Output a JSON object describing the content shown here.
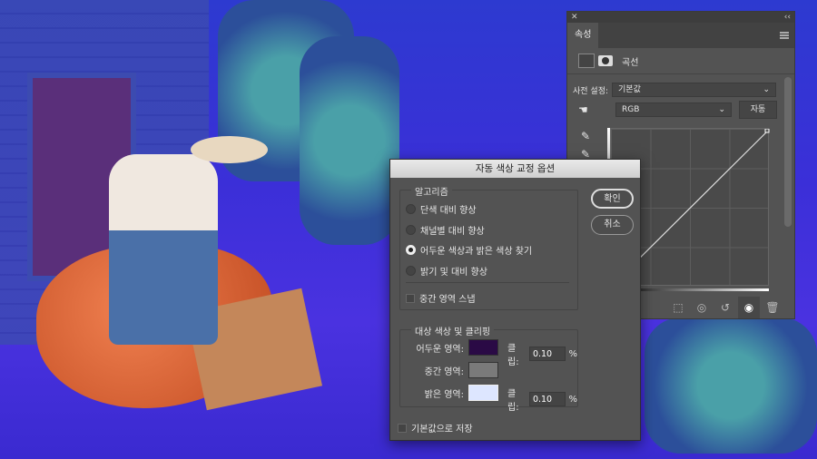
{
  "properties_panel": {
    "close": "✕",
    "collapse": "‹‹",
    "tab": "속성",
    "type_label": "곡선",
    "preset_label": "사전 설정:",
    "preset_value": "기본값",
    "channel_value": "RGB",
    "auto_button": "자동"
  },
  "dialog": {
    "title": "자동 색상 교정 옵션",
    "algorithm_label": "알고리즘",
    "algorithms": [
      {
        "label": "단색 대비 향상",
        "selected": false
      },
      {
        "label": "채널별 대비 향상",
        "selected": false
      },
      {
        "label": "어두운 색상과 밝은 색상 찾기",
        "selected": true
      },
      {
        "label": "밝기 및 대비 향상",
        "selected": false
      }
    ],
    "snap_midtones": {
      "label": "중간 영역 스냅",
      "checked": false
    },
    "target_label": "대상 색상 및 클리핑",
    "shadows": {
      "label": "어두운 영역:",
      "color": "#2a0a45",
      "clip_label": "클립:",
      "clip": "0.10",
      "unit": "%"
    },
    "midtones": {
      "label": "중간 영역:",
      "color": "#7a7a7a"
    },
    "highlights": {
      "label": "밝은 영역:",
      "color": "#dde6ff",
      "clip_label": "클립:",
      "clip": "0.10",
      "unit": "%"
    },
    "save_default": {
      "label": "기본값으로 저장",
      "checked": false
    },
    "ok": "확인",
    "cancel": "취소"
  }
}
